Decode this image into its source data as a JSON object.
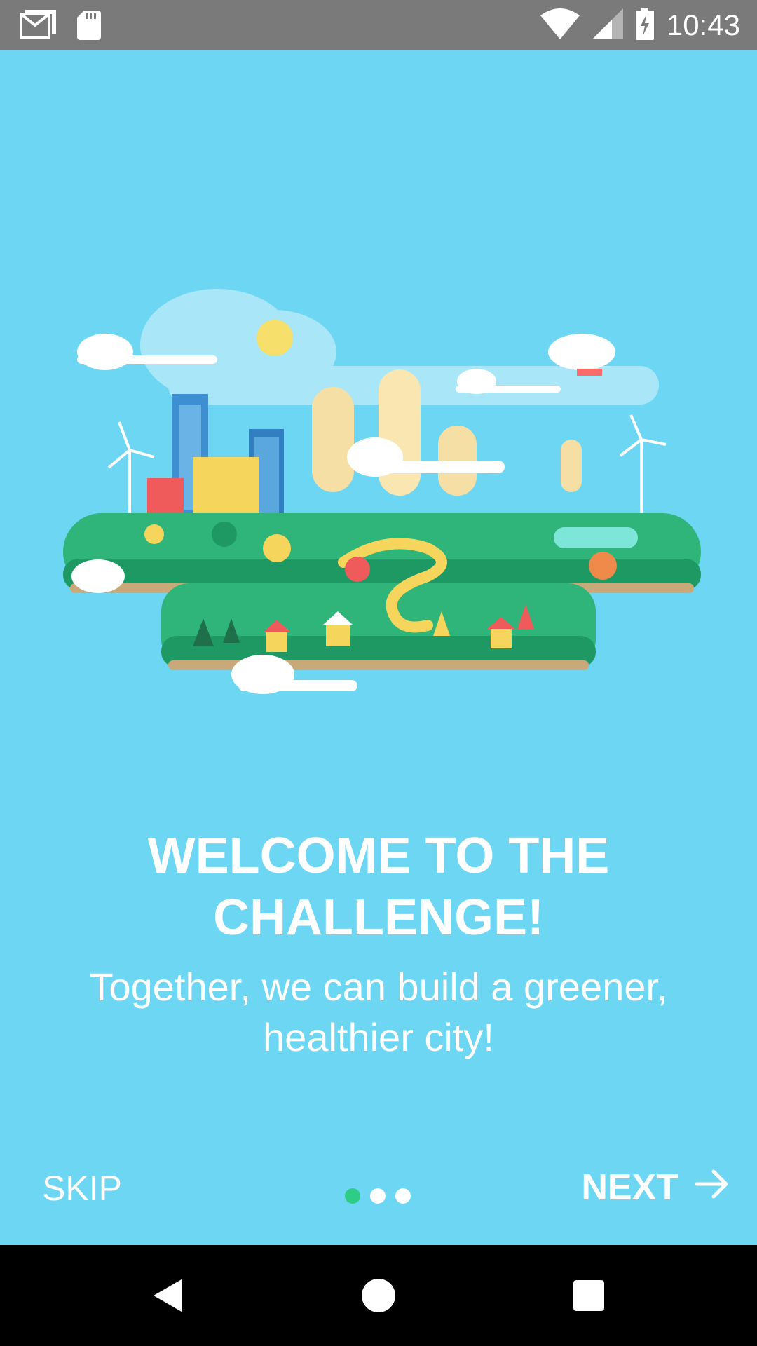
{
  "status_bar": {
    "time": "10:43",
    "icons": [
      "gmail-icon",
      "sd-card-icon",
      "wifi-icon",
      "signal-icon",
      "battery-charging-icon"
    ]
  },
  "onboarding": {
    "illustration": "green-city-illustration",
    "title": "WELCOME TO THE CHALLENGE!",
    "subtitle": "Together, we can build a greener, healthier city!"
  },
  "footer": {
    "skip_label": "SKIP",
    "next_label": "NEXT",
    "page_count": 3,
    "active_page": 1,
    "active_dot_color": "#2ecc86"
  },
  "colors": {
    "background": "#6dd6f3",
    "status_bar": "#7a7a7a",
    "nav_bar": "#000000"
  },
  "nav_bar": {
    "buttons": [
      "back-icon",
      "home-icon",
      "recents-icon"
    ]
  }
}
